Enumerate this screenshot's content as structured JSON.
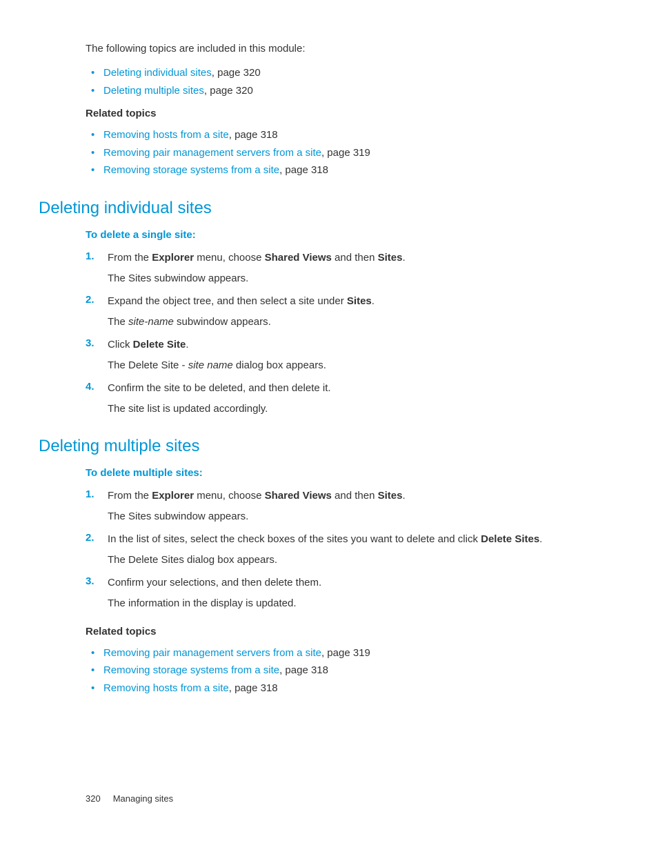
{
  "intro": "The following topics are included in this module:",
  "module_topics": [
    {
      "link": "Deleting individual sites",
      "suffix": ", page 320"
    },
    {
      "link": "Deleting multiple sites",
      "suffix": ", page 320"
    }
  ],
  "related1": {
    "heading": "Related topics",
    "items": [
      {
        "link": "Removing hosts from a site",
        "suffix": ", page 318"
      },
      {
        "link": "Removing pair management servers from a site",
        "suffix": ", page 319"
      },
      {
        "link": "Removing storage systems from a site",
        "suffix": ", page 318"
      }
    ]
  },
  "section1": {
    "title": "Deleting individual sites",
    "subheading": "To delete a single site:",
    "steps": [
      {
        "num": "1.",
        "main": {
          "pre": "From the ",
          "b1": "Explorer",
          "mid": " menu, choose ",
          "b2": "Shared Views",
          "mid2": " and then ",
          "b3": "Sites",
          "post": "."
        },
        "sub": "The Sites subwindow appears."
      },
      {
        "num": "2.",
        "main": {
          "pre": "Expand the object tree, and then select a site under ",
          "b1": "Sites",
          "post": "."
        },
        "sub_parts": {
          "pre": "The ",
          "it": "site-name",
          "post": " subwindow appears."
        }
      },
      {
        "num": "3.",
        "main": {
          "pre": "Click ",
          "b1": "Delete Site",
          "post": "."
        },
        "sub_parts": {
          "pre": "The Delete Site - ",
          "it": "site name",
          "post": " dialog box appears."
        }
      },
      {
        "num": "4.",
        "main": {
          "pre": "Confirm the site to be deleted, and then delete it."
        },
        "sub": "The site list is updated accordingly."
      }
    ]
  },
  "section2": {
    "title": "Deleting multiple sites",
    "subheading": "To delete multiple sites:",
    "steps": [
      {
        "num": "1.",
        "main": {
          "pre": "From the ",
          "b1": "Explorer",
          "mid": " menu, choose ",
          "b2": "Shared Views",
          "mid2": " and then ",
          "b3": "Sites",
          "post": "."
        },
        "sub": "The Sites subwindow appears."
      },
      {
        "num": "2.",
        "main": {
          "pre": "In the list of sites, select the check boxes of the sites you want to delete and click ",
          "b1": "Delete Sites",
          "post": "."
        },
        "sub": "The Delete Sites dialog box appears."
      },
      {
        "num": "3.",
        "main": {
          "pre": "Confirm your selections, and then delete them."
        },
        "sub": "The information in the display is updated."
      }
    ]
  },
  "related2": {
    "heading": "Related topics",
    "items": [
      {
        "link": "Removing pair management servers from a site",
        "suffix": ", page 319"
      },
      {
        "link": "Removing storage systems from a site",
        "suffix": ", page 318"
      },
      {
        "link": "Removing hosts from a site",
        "suffix": ", page 318"
      }
    ]
  },
  "footer": {
    "page": "320",
    "label": "Managing sites"
  }
}
